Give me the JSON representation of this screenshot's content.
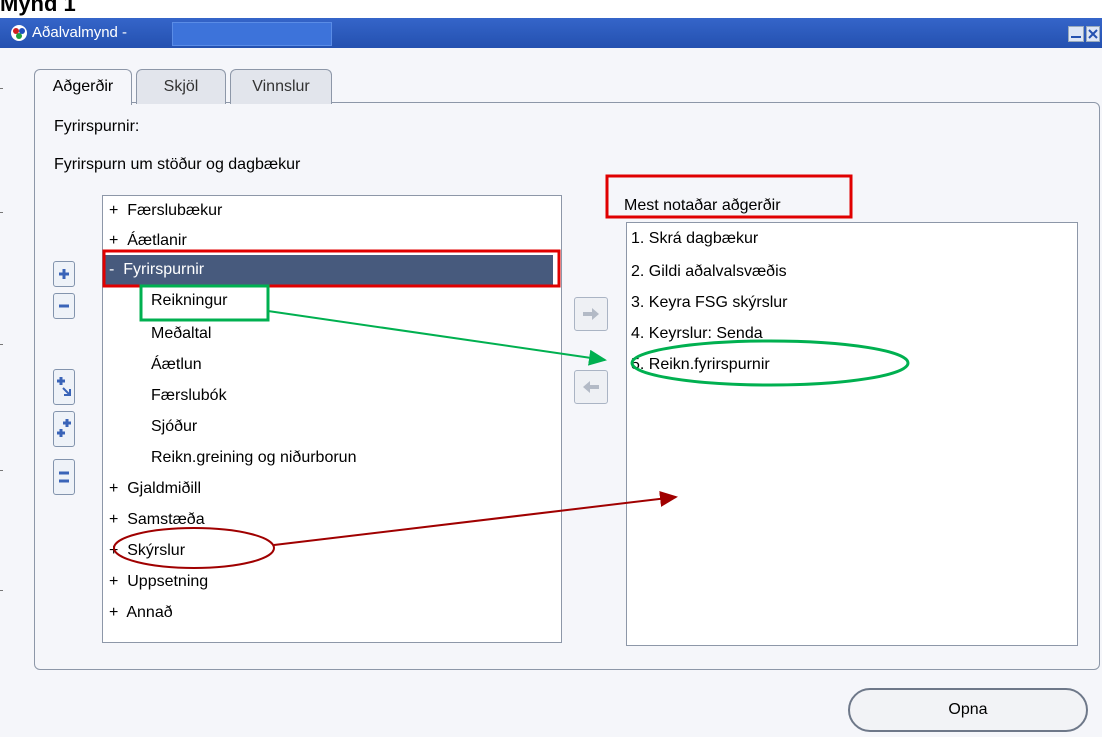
{
  "caption": "Mynd 1",
  "window": {
    "title": "Aðalvalmynd -",
    "icon": "oracle-apps-icon",
    "buttons": [
      "minimize-icon",
      "close-icon"
    ]
  },
  "tabs": [
    {
      "label": "Aðgerðir",
      "active": true
    },
    {
      "label": "Skjöl",
      "active": false
    },
    {
      "label": "Vinnslur",
      "active": false
    }
  ],
  "panel": {
    "heading": "Fyrirspurnir:",
    "subheading": "Fyrirspurn um stöður og dagbækur",
    "right_heading": "Mest notaðar aðgerðir",
    "open_button": "Opna"
  },
  "tree": [
    {
      "prefix": "+",
      "label": "Færslubækur"
    },
    {
      "prefix": "+",
      "label": "Áætlanir"
    },
    {
      "prefix": "-",
      "label": "Fyrirspurnir",
      "selected": true
    },
    {
      "prefix": "",
      "label": "Reikningur"
    },
    {
      "prefix": "",
      "label": "Meðaltal"
    },
    {
      "prefix": "",
      "label": "Áætlun"
    },
    {
      "prefix": "",
      "label": "Færslubók"
    },
    {
      "prefix": "",
      "label": "Sjóður"
    },
    {
      "prefix": "",
      "label": "Reikn.greining og niðurborun"
    },
    {
      "prefix": "+",
      "label": "Gjaldmiðill"
    },
    {
      "prefix": "+",
      "label": "Samstæða"
    },
    {
      "prefix": "+",
      "label": "Skýrslur"
    },
    {
      "prefix": "+",
      "label": "Uppsetning"
    },
    {
      "prefix": "+",
      "label": "Annað"
    }
  ],
  "favorites": [
    "1. Skrá dagbækur",
    "2. Gildi aðalvalsvæðis",
    "3. Keyra FSG skýrslur",
    "4. Keyrslur: Senda",
    "5. Reikn.fyrirspurnir"
  ],
  "side_buttons": [
    "expand-icon",
    "collapse-icon",
    "expand-branch-icon",
    "expand-all-icon",
    "collapse-all-icon"
  ],
  "colors": {
    "titlebar": "#2451b0",
    "selection": "#475a7d",
    "annotation_red": "#e00000",
    "annotation_green": "#00b050",
    "annotation_darkred": "#a00000"
  }
}
